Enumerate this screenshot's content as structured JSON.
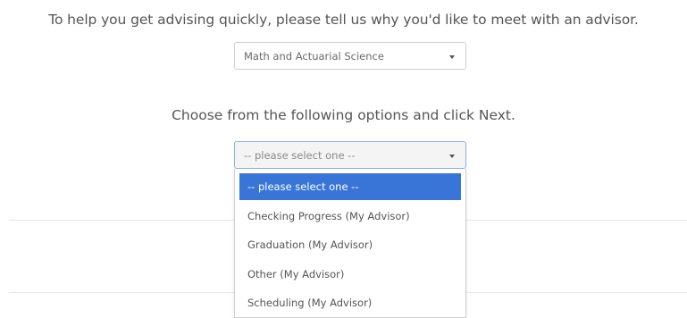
{
  "intro_text": "To help you get advising quickly, please tell us why you'd like to meet with an advisor.",
  "department_select": {
    "value": "Math and Actuarial Science"
  },
  "prompt_text": "Choose from the following options and click Next.",
  "reason_select": {
    "value": "-- please select one --",
    "options": [
      "-- please select one --",
      "Checking Progress (My Advisor)",
      "Graduation (My Advisor)",
      "Other (My Advisor)",
      "Scheduling (My Advisor)"
    ],
    "selected_index": 0
  },
  "colors": {
    "text": "#555555",
    "highlight": "#3875d7",
    "border": "#cfcfcf"
  },
  "icons": {
    "caret": "caret-down-icon"
  }
}
